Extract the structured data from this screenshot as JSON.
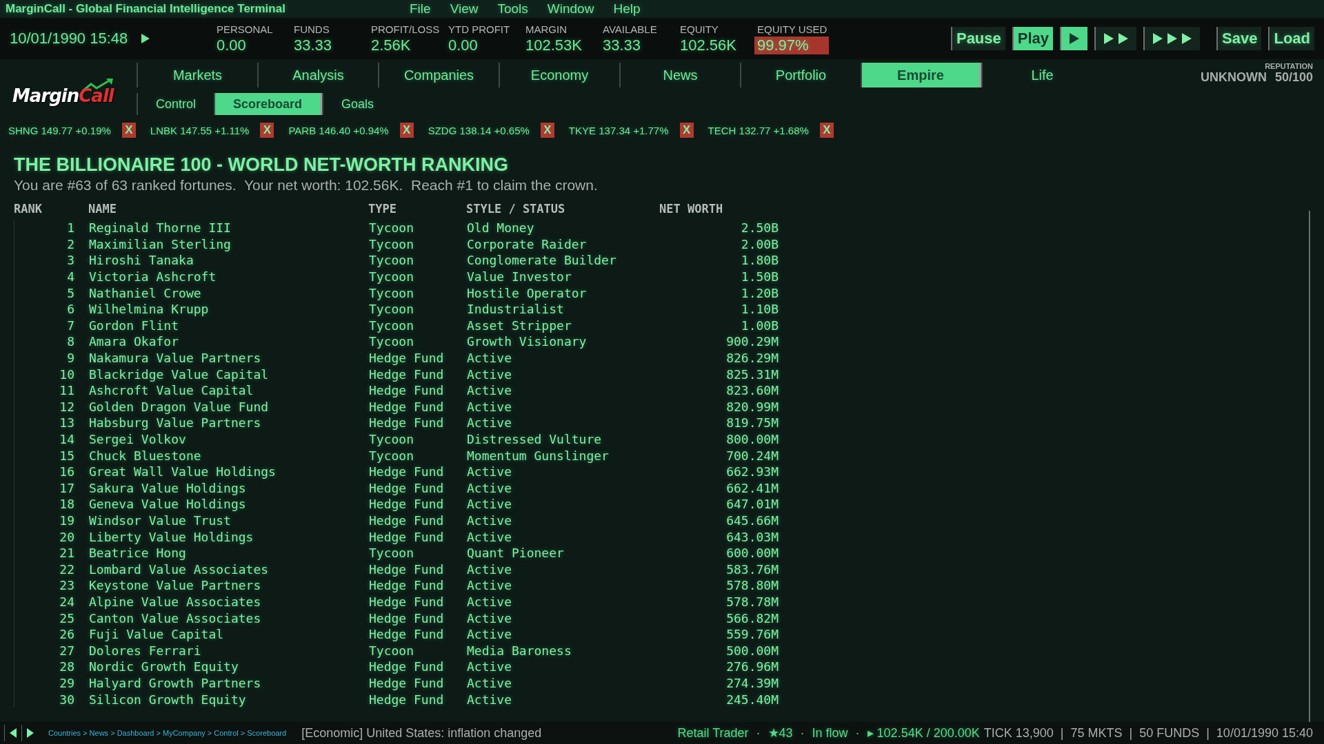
{
  "window": {
    "title": "MarginCall - Global Financial Intelligence Terminal",
    "menu": [
      "File",
      "View",
      "Tools",
      "Window",
      "Help"
    ]
  },
  "clock": {
    "datetime": "10/01/1990 15:48",
    "playing": true
  },
  "stats": [
    {
      "label": "PERSONAL",
      "value": "0.00",
      "alert": false
    },
    {
      "label": "FUNDS",
      "value": "33.33",
      "alert": false
    },
    {
      "label": "PROFIT/LOSS",
      "value": "2.56K",
      "alert": false
    },
    {
      "label": "YTD PROFIT",
      "value": "0.00",
      "alert": false
    },
    {
      "label": "MARGIN",
      "value": "102.53K",
      "alert": false
    },
    {
      "label": "AVAILABLE",
      "value": "33.33",
      "alert": false
    },
    {
      "label": "EQUITY",
      "value": "102.56K",
      "alert": false
    },
    {
      "label": "EQUITY USED",
      "value": "99.97%",
      "alert": true
    }
  ],
  "controls": [
    {
      "kind": "text",
      "label": "Pause",
      "selected": false
    },
    {
      "kind": "text",
      "label": "Play",
      "selected": true
    },
    {
      "kind": "normal",
      "selected": true
    },
    {
      "kind": "fast",
      "selected": false
    },
    {
      "kind": "fastest",
      "selected": false
    },
    {
      "kind": "text",
      "label": "Save",
      "selected": false,
      "gap": true
    },
    {
      "kind": "text",
      "label": "Load",
      "selected": false
    }
  ],
  "logo": {
    "first": "Margin",
    "second": "Call"
  },
  "tabs": [
    {
      "label": "Markets",
      "selected": false
    },
    {
      "label": "Analysis",
      "selected": false
    },
    {
      "label": "Companies",
      "selected": false
    },
    {
      "label": "Economy",
      "selected": false
    },
    {
      "label": "News",
      "selected": false
    },
    {
      "label": "Portfolio",
      "selected": false
    },
    {
      "label": "Empire",
      "selected": true
    },
    {
      "label": "Life",
      "selected": false
    }
  ],
  "subtabs": [
    {
      "label": "Control",
      "selected": false
    },
    {
      "label": "Scoreboard",
      "selected": true
    },
    {
      "label": "Goals",
      "selected": false
    }
  ],
  "reputation": {
    "label": "REPUTATION",
    "status": "UNKNOWN",
    "score": "50/100"
  },
  "ticker": [
    {
      "text": "SHNG 149.77 +0.19%",
      "remove": "X"
    },
    {
      "text": "LNBK 147.55 +1.11%",
      "remove": "X"
    },
    {
      "text": "PARB 146.40 +0.94%",
      "remove": "X"
    },
    {
      "text": "SZDG 138.14 +0.65%",
      "remove": "X"
    },
    {
      "text": "TKYE 137.34 +1.77%",
      "remove": "X"
    },
    {
      "text": "TECH 132.77 +1.68%",
      "remove": "X"
    }
  ],
  "ranking": {
    "title": "THE BILLIONAIRE 100 - WORLD NET-WORTH RANKING",
    "summary": "You are #63 of 63 ranked fortunes.  Your net worth: 102.56K.  Reach #1 to claim the crown.",
    "columns": [
      "RANK",
      "NAME",
      "TYPE",
      "STYLE / STATUS",
      "NET WORTH"
    ],
    "rows": [
      [
        "1",
        "Reginald Thorne III",
        "Tycoon",
        "Old Money",
        "2.50B"
      ],
      [
        "2",
        "Maximilian Sterling",
        "Tycoon",
        "Corporate Raider",
        "2.00B"
      ],
      [
        "3",
        "Hiroshi Tanaka",
        "Tycoon",
        "Conglomerate Builder",
        "1.80B"
      ],
      [
        "4",
        "Victoria Ashcroft",
        "Tycoon",
        "Value Investor",
        "1.50B"
      ],
      [
        "5",
        "Nathaniel Crowe",
        "Tycoon",
        "Hostile Operator",
        "1.20B"
      ],
      [
        "6",
        "Wilhelmina Krupp",
        "Tycoon",
        "Industrialist",
        "1.10B"
      ],
      [
        "7",
        "Gordon Flint",
        "Tycoon",
        "Asset Stripper",
        "1.00B"
      ],
      [
        "8",
        "Amara Okafor",
        "Tycoon",
        "Growth Visionary",
        "900.29M"
      ],
      [
        "9",
        "Nakamura Value Partners",
        "Hedge Fund",
        "Active",
        "826.29M"
      ],
      [
        "10",
        "Blackridge Value Capital",
        "Hedge Fund",
        "Active",
        "825.31M"
      ],
      [
        "11",
        "Ashcroft Value Capital",
        "Hedge Fund",
        "Active",
        "823.60M"
      ],
      [
        "12",
        "Golden Dragon Value Fund",
        "Hedge Fund",
        "Active",
        "820.99M"
      ],
      [
        "13",
        "Habsburg Value Partners",
        "Hedge Fund",
        "Active",
        "819.75M"
      ],
      [
        "14",
        "Sergei Volkov",
        "Tycoon",
        "Distressed Vulture",
        "800.00M"
      ],
      [
        "15",
        "Chuck Bluestone",
        "Tycoon",
        "Momentum Gunslinger",
        "700.24M"
      ],
      [
        "16",
        "Great Wall Value Holdings",
        "Hedge Fund",
        "Active",
        "662.93M"
      ],
      [
        "17",
        "Sakura Value Holdings",
        "Hedge Fund",
        "Active",
        "662.41M"
      ],
      [
        "18",
        "Geneva Value Holdings",
        "Hedge Fund",
        "Active",
        "647.01M"
      ],
      [
        "19",
        "Windsor Value Trust",
        "Hedge Fund",
        "Active",
        "645.66M"
      ],
      [
        "20",
        "Liberty Value Holdings",
        "Hedge Fund",
        "Active",
        "643.03M"
      ],
      [
        "21",
        "Beatrice Hong",
        "Tycoon",
        "Quant Pioneer",
        "600.00M"
      ],
      [
        "22",
        "Lombard Value Associates",
        "Hedge Fund",
        "Active",
        "583.76M"
      ],
      [
        "23",
        "Keystone Value Partners",
        "Hedge Fund",
        "Active",
        "578.80M"
      ],
      [
        "24",
        "Alpine Value Associates",
        "Hedge Fund",
        "Active",
        "578.78M"
      ],
      [
        "25",
        "Canton Value Associates",
        "Hedge Fund",
        "Active",
        "566.82M"
      ],
      [
        "26",
        "Fuji Value Capital",
        "Hedge Fund",
        "Active",
        "559.76M"
      ],
      [
        "27",
        "Dolores Ferrari",
        "Tycoon",
        "Media Baroness",
        "500.00M"
      ],
      [
        "28",
        "Nordic Growth Equity",
        "Hedge Fund",
        "Active",
        "276.96M"
      ],
      [
        "29",
        "Halyard Growth Partners",
        "Hedge Fund",
        "Active",
        "274.39M"
      ],
      [
        "30",
        "Silicon Growth Equity",
        "Hedge Fund",
        "Active",
        "245.40M"
      ]
    ]
  },
  "status_bar": {
    "breadcrumb": "Countries > News > Dashboard > MyCompany > Control > Scoreboard",
    "message": "[Economic] United States: inflation changed",
    "separator": "·",
    "profile": [
      "Retail Trader",
      "★43",
      "In flow",
      "▸ 102.54K / 200.00K"
    ],
    "stats": "TICK 13,900  |  75 MKTS  |  50 FUNDS  |  10/01/1990 15:40"
  }
}
